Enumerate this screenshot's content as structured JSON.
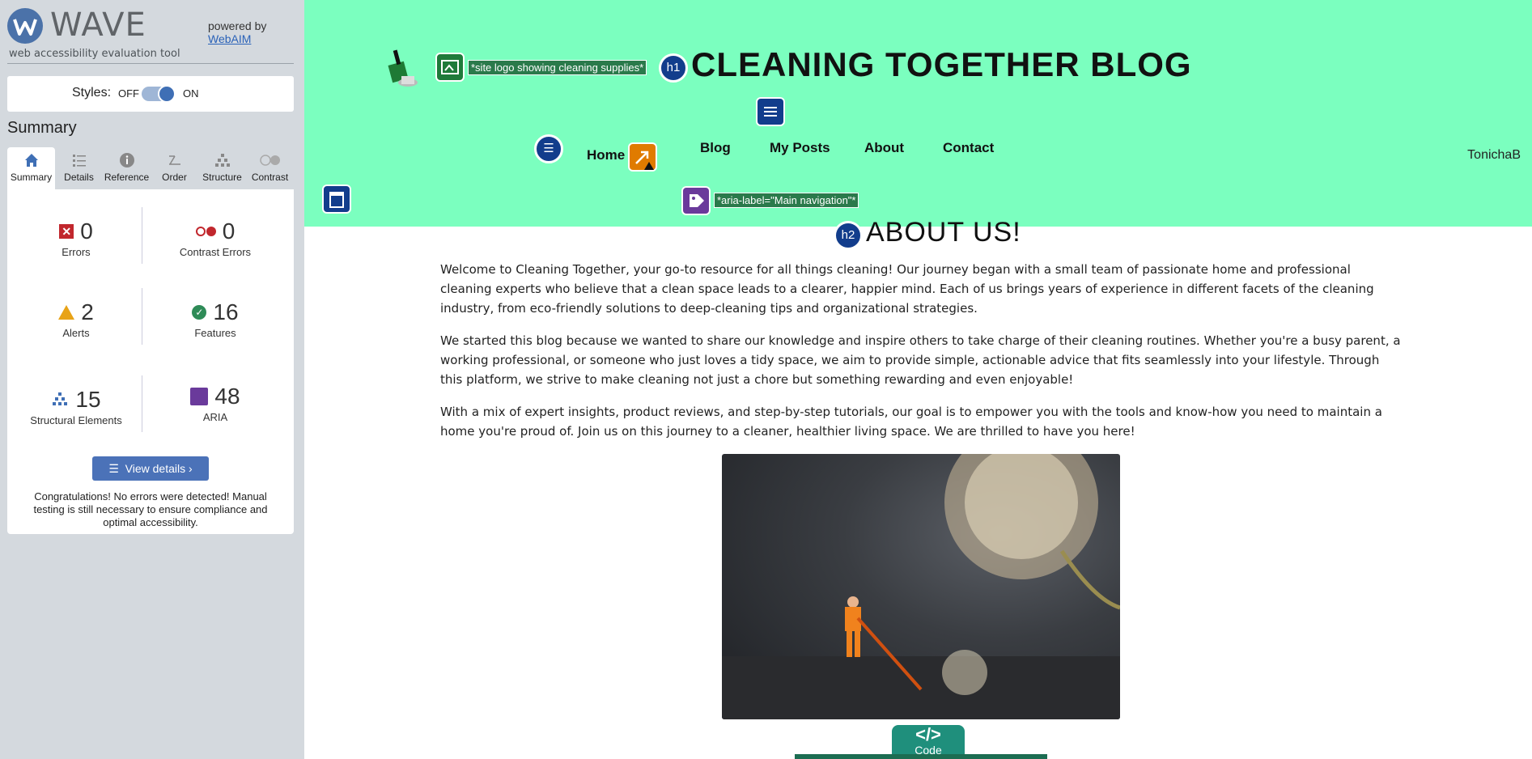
{
  "wave": {
    "brand": "WAVE",
    "tagline": "web accessibility evaluation tool",
    "powered_by": "powered by",
    "powered_link": "WebAIM",
    "styles_label": "Styles:",
    "styles_off": "OFF",
    "styles_on": "ON",
    "styles_state": "on",
    "summary_heading": "Summary",
    "tabs": [
      {
        "label": "Summary",
        "icon": "home-icon"
      },
      {
        "label": "Details",
        "icon": "list-icon"
      },
      {
        "label": "Reference",
        "icon": "info-icon"
      },
      {
        "label": "Order",
        "icon": "order-icon"
      },
      {
        "label": "Structure",
        "icon": "structure-icon"
      },
      {
        "label": "Contrast",
        "icon": "contrast-icon"
      }
    ],
    "stats": {
      "errors": {
        "value": "0",
        "label": "Errors"
      },
      "contrast_errors": {
        "value": "0",
        "label": "Contrast Errors"
      },
      "alerts": {
        "value": "2",
        "label": "Alerts"
      },
      "features": {
        "value": "16",
        "label": "Features"
      },
      "structural": {
        "value": "15",
        "label": "Structural Elements"
      },
      "aria": {
        "value": "48",
        "label": "ARIA"
      }
    },
    "view_details": "View details ›",
    "congrats": "Congratulations! No errors were detected! Manual testing is still necessary to ensure compliance and optimal accessibility."
  },
  "page": {
    "logo_alt_annotation": "*site logo showing cleaning supplies*",
    "h1_badge": "h1",
    "h2_badge": "h2",
    "site_title": "CLEANING TOGETHER BLOG",
    "nav": [
      "Home",
      "Blog",
      "My Posts",
      "About",
      "Contact"
    ],
    "user": "TonichaB",
    "aria_label_annotation": "*aria-label=\"Main navigation\"*",
    "about_heading": "ABOUT US!",
    "paragraphs": [
      "Welcome to Cleaning Together, your go-to resource for all things cleaning! Our journey began with a small team of passionate home and professional cleaning experts who believe that a clean space leads to a clearer, happier mind. Each of us brings years of experience in different facets of the cleaning industry, from eco-friendly solutions to deep-cleaning tips and organizational strategies.",
      "We started this blog because we wanted to share our knowledge and inspire others to take charge of their cleaning routines. Whether you're a busy parent, a working professional, or someone who just loves a tidy space, we aim to provide simple, actionable advice that fits seamlessly into your lifestyle. Through this platform, we strive to make cleaning not just a chore but something rewarding and even enjoyable!",
      "With a mix of expert insights, product reviews, and step-by-step tutorials, our goal is to empower you with the tools and know-how you need to maintain a home you're proud of. Join us on this journey to a cleaner, healthier living space. We are thrilled to have you here!"
    ],
    "code_badge": "Code",
    "colors": {
      "header_bg": "#7bffbf",
      "wave_blue": "#4b72b8",
      "error_red": "#c1272d",
      "alert_amber": "#e8a317",
      "feature_green": "#2e8b57",
      "aria_purple": "#6a3a9b",
      "structure_navy": "#123d8c"
    }
  }
}
